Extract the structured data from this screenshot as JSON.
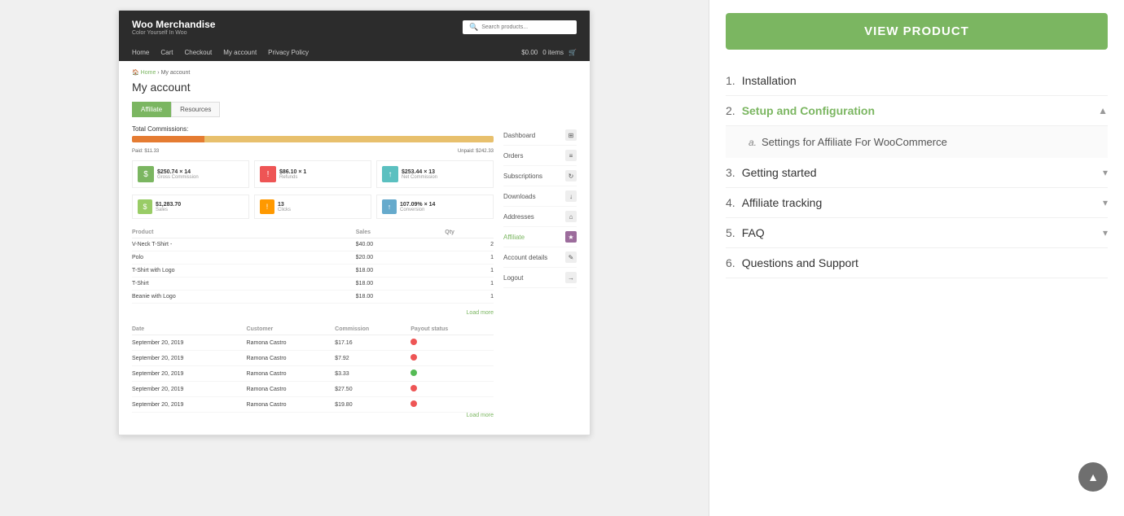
{
  "left": {
    "woo": {
      "logo_title": "Woo Merchandise",
      "logo_sub": "Color Yourself In Woo",
      "search_placeholder": "Search products...",
      "nav_links": [
        "Home",
        "Cart",
        "Checkout",
        "My account",
        "Privacy Policy"
      ],
      "cart_text": "$0.00",
      "cart_items": "0 items",
      "breadcrumb_home": "Home",
      "breadcrumb_sep": "›",
      "breadcrumb_current": "My account",
      "page_title": "My account",
      "tabs": [
        {
          "label": "Affiliate",
          "active": true
        },
        {
          "label": "Resources",
          "active": false
        }
      ],
      "commissions_label": "Total Commissions:",
      "paid_label": "Paid: $11.33",
      "unpaid_label": "Unpaid: $242.33",
      "stats": [
        {
          "value": "$250.74 × 14",
          "sub": "Gross Commission",
          "icon": "$",
          "color": "green"
        },
        {
          "value": "$86.10 × 1",
          "sub": "Refunds",
          "icon": "!",
          "color": "red"
        },
        {
          "value": "$253.44 × 13",
          "sub": "Net Commission",
          "icon": "↑",
          "color": "teal"
        }
      ],
      "stats2": [
        {
          "value": "$1,283.70",
          "sub": "Sales",
          "icon": "📦",
          "color": "purple"
        },
        {
          "value": "13",
          "sub": "Clicks",
          "icon": "!",
          "color": "orange"
        },
        {
          "value": "107.09% × 14",
          "sub": "Conversion",
          "icon": "↑",
          "color": "blue"
        }
      ],
      "products_headers": [
        "Product",
        "Sales",
        "Qty"
      ],
      "products": [
        {
          "name": "V-Neck T-Shirt -",
          "sales": "$40.00",
          "qty": "2"
        },
        {
          "name": "Polo",
          "sales": "$20.00",
          "qty": "1"
        },
        {
          "name": "T-Shirt with Logo",
          "sales": "$18.00",
          "qty": "1"
        },
        {
          "name": "T-Shirt",
          "sales": "$18.00",
          "qty": "1"
        },
        {
          "name": "Beanie with Logo",
          "sales": "$18.00",
          "qty": "1"
        }
      ],
      "load_more": "Load more",
      "commissions_headers": [
        "Date",
        "Customer",
        "Commission",
        "Payout status"
      ],
      "commissions": [
        {
          "date": "September 20, 2019",
          "customer": "Ramona Castro",
          "commission": "$17.16",
          "status": "red"
        },
        {
          "date": "September 20, 2019",
          "customer": "Ramona Castro",
          "commission": "$7.92",
          "status": "red"
        },
        {
          "date": "September 20, 2019",
          "customer": "Ramona Castro",
          "commission": "$3.33",
          "status": "green"
        },
        {
          "date": "September 20, 2019",
          "customer": "Ramona Castro",
          "commission": "$27.50",
          "status": "red"
        },
        {
          "date": "September 20, 2019",
          "customer": "Ramona Castro",
          "commission": "$19.80",
          "status": "red"
        }
      ],
      "load_more2": "Load more",
      "sidebar_menu": [
        {
          "label": "Dashboard",
          "icon": "⊞",
          "color": "default"
        },
        {
          "label": "Orders",
          "icon": "≡",
          "color": "default"
        },
        {
          "label": "Subscriptions",
          "icon": "↻",
          "color": "default"
        },
        {
          "label": "Downloads",
          "icon": "↓",
          "color": "default"
        },
        {
          "label": "Addresses",
          "icon": "⌂",
          "color": "default"
        },
        {
          "label": "Affiliate",
          "icon": "★",
          "color": "purple",
          "active": true
        },
        {
          "label": "Account details",
          "icon": "✎",
          "color": "default"
        },
        {
          "label": "Logout",
          "icon": "→",
          "color": "default"
        }
      ]
    }
  },
  "right": {
    "view_product_btn": "VIEW PRODUCT",
    "toc_items": [
      {
        "number": "1.",
        "title": "Installation",
        "has_chevron": false,
        "expanded": false,
        "sub_items": []
      },
      {
        "number": "2.",
        "title": "Setup and Configuration",
        "has_chevron": true,
        "expanded": true,
        "sub_items": [
          {
            "letter": "a.",
            "title": "Settings for Affiliate For WooCommerce"
          }
        ]
      },
      {
        "number": "3.",
        "title": "Getting started",
        "has_chevron": true,
        "expanded": false,
        "sub_items": []
      },
      {
        "number": "4.",
        "title": "Affiliate tracking",
        "has_chevron": true,
        "expanded": false,
        "sub_items": []
      },
      {
        "number": "5.",
        "title": "FAQ",
        "has_chevron": true,
        "expanded": false,
        "sub_items": []
      },
      {
        "number": "6.",
        "title": "Questions and Support",
        "has_chevron": false,
        "expanded": false,
        "sub_items": []
      }
    ],
    "scroll_up_icon": "▲"
  }
}
